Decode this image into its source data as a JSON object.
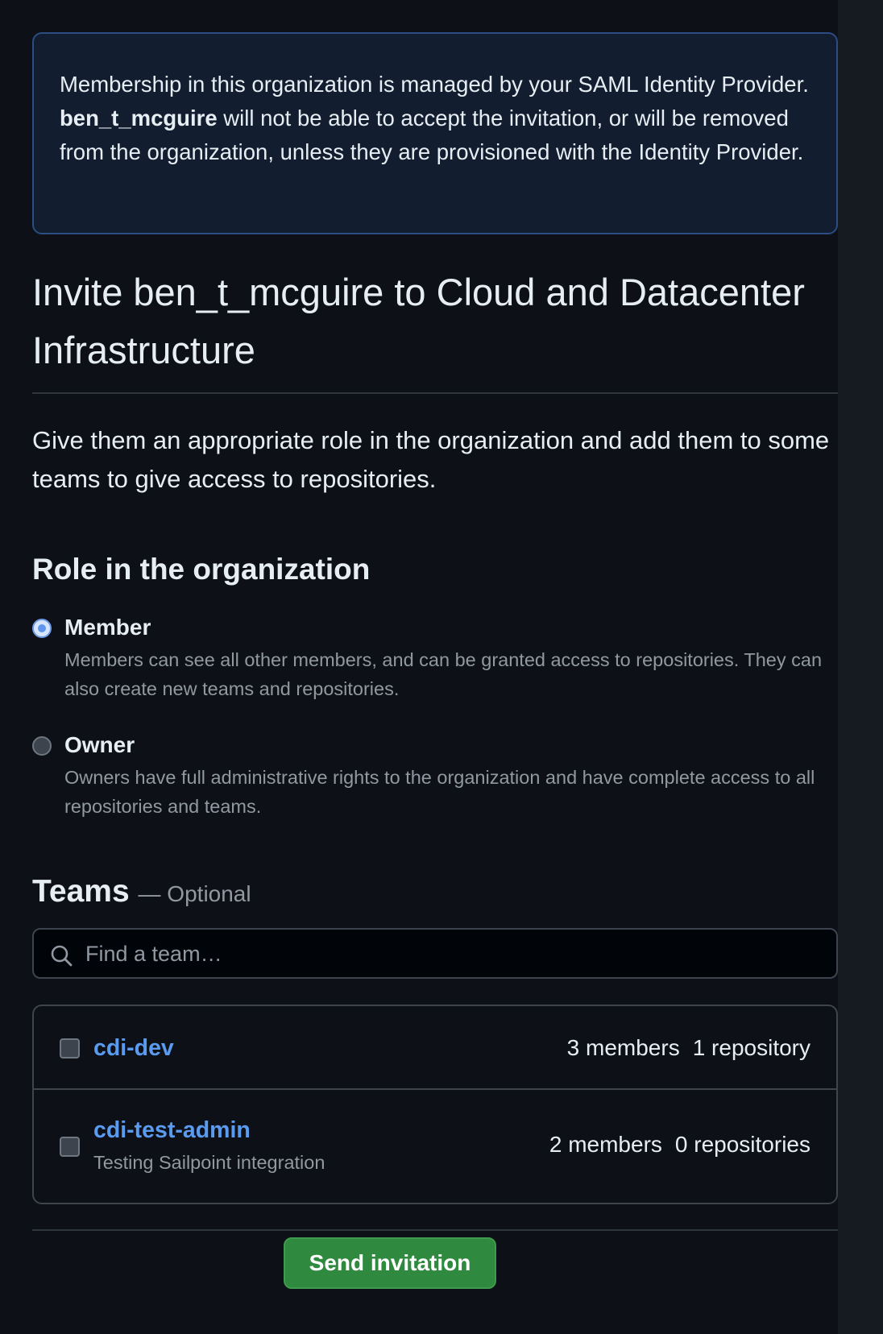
{
  "notice": {
    "text_before": "Membership in this organization is managed by your SAML Identity Provider. ",
    "username": "ben_t_mcguire",
    "text_after": " will not be able to accept the invitation, or will be removed from the organization, unless they are provisioned with the Identity Provider."
  },
  "page": {
    "title": "Invite ben_t_mcguire to Cloud and Datacenter Infrastructure",
    "lead": "Give them an appropriate role in the organization and add them to some teams to give access to repositories."
  },
  "role": {
    "heading": "Role in the organization",
    "selected": "member",
    "options": [
      {
        "label": "Member",
        "description": "Members can see all other members, and can be granted access to repositories. They can also create new teams and repositories."
      },
      {
        "label": "Owner",
        "description": "Owners have full administrative rights to the organization and have complete access to all repositories and teams."
      }
    ]
  },
  "teams": {
    "heading": "Teams",
    "optional_label": "— Optional",
    "search_placeholder": "Find a team…",
    "search_value": "",
    "items": [
      {
        "name": "cdi-dev",
        "description": "",
        "members": "3 members",
        "repositories": "1 repository",
        "checked": false
      },
      {
        "name": "cdi-test-admin",
        "description": "Testing Sailpoint integration",
        "members": "2 members",
        "repositories": "0 repositories",
        "checked": false
      }
    ]
  },
  "actions": {
    "send_label": "Send invitation"
  },
  "colors": {
    "background": "#0d1117",
    "notice_border": "#2b4d82",
    "link": "#5a9bf0",
    "primary_button": "#2f8a3f",
    "muted_text": "#9198a1"
  },
  "icons": {
    "search": "search-icon"
  }
}
